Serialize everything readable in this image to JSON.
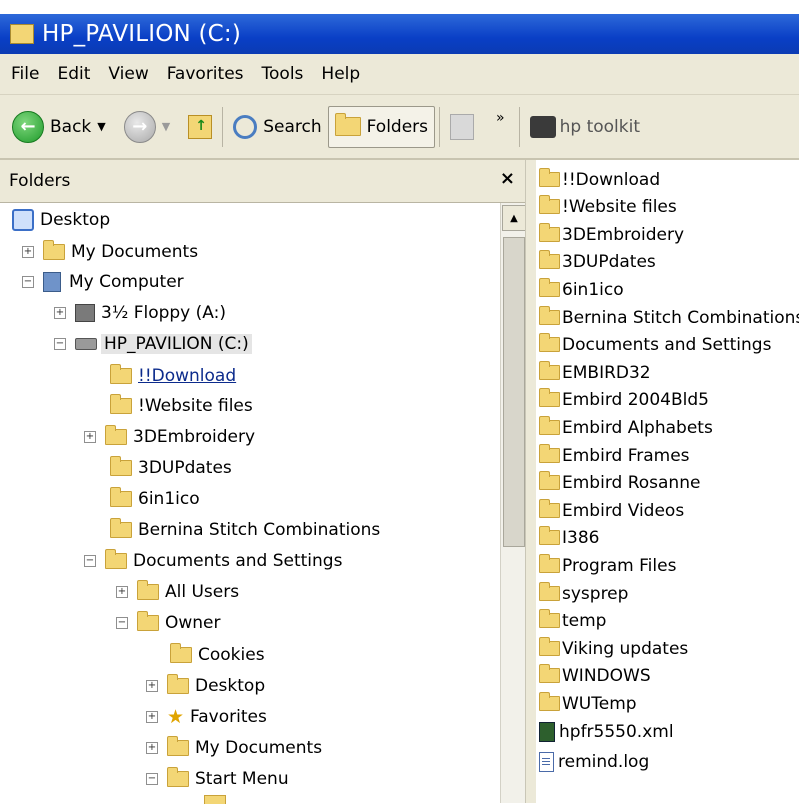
{
  "window": {
    "title": "HP_PAVILION (C:)"
  },
  "menu": [
    "File",
    "Edit",
    "View",
    "Favorites",
    "Tools",
    "Help"
  ],
  "toolbar": {
    "back_label": "Back",
    "search_label": "Search",
    "folders_label": "Folders",
    "chevron": "»",
    "hp_toolkit_label": "hp toolkit"
  },
  "folders_pane": {
    "title": "Folders",
    "close": "×",
    "tree": [
      {
        "label": "Desktop",
        "icon": "desktop-icon",
        "expander": ""
      },
      {
        "label": "My Documents",
        "icon": "folder-icon",
        "expander": "+"
      },
      {
        "label": "My Computer",
        "icon": "computer-icon",
        "expander": "−"
      },
      {
        "label": "3½ Floppy (A:)",
        "icon": "floppy-icon",
        "expander": "+"
      },
      {
        "label": "HP_PAVILION (C:)",
        "icon": "drive-icon",
        "expander": "−",
        "selected": true
      },
      {
        "label": "!!Download",
        "icon": "folder-icon",
        "expander": "",
        "link": true
      },
      {
        "label": "!Website files",
        "icon": "folder-icon",
        "expander": ""
      },
      {
        "label": "3DEmbroidery",
        "icon": "folder-icon",
        "expander": "+"
      },
      {
        "label": "3DUPdates",
        "icon": "folder-icon",
        "expander": ""
      },
      {
        "label": "6in1ico",
        "icon": "folder-icon",
        "expander": ""
      },
      {
        "label": "Bernina Stitch Combinations",
        "icon": "folder-icon",
        "expander": ""
      },
      {
        "label": "Documents and Settings",
        "icon": "folder-icon",
        "expander": "−"
      },
      {
        "label": "All Users",
        "icon": "folder-icon",
        "expander": "+"
      },
      {
        "label": "Owner",
        "icon": "folder-icon",
        "expander": "−"
      },
      {
        "label": "Cookies",
        "icon": "folder-icon",
        "expander": ""
      },
      {
        "label": "Desktop",
        "icon": "folder-icon",
        "expander": "+"
      },
      {
        "label": "Favorites",
        "icon": "star-icon",
        "expander": "+"
      },
      {
        "label": "My Documents",
        "icon": "folder-icon",
        "expander": "+"
      },
      {
        "label": "Start Menu",
        "icon": "folder-icon",
        "expander": "−"
      }
    ]
  },
  "contents": [
    {
      "label": "!!Download",
      "icon": "folder-icon"
    },
    {
      "label": "!Website files",
      "icon": "folder-icon"
    },
    {
      "label": "3DEmbroidery",
      "icon": "folder-icon"
    },
    {
      "label": "3DUPdates",
      "icon": "folder-icon"
    },
    {
      "label": "6in1ico",
      "icon": "folder-icon"
    },
    {
      "label": "Bernina Stitch Combinations",
      "icon": "folder-icon"
    },
    {
      "label": "Documents and Settings",
      "icon": "folder-icon"
    },
    {
      "label": "EMBIRD32",
      "icon": "folder-icon"
    },
    {
      "label": "Embird 2004Bld5",
      "icon": "folder-icon"
    },
    {
      "label": "Embird Alphabets",
      "icon": "folder-icon"
    },
    {
      "label": "Embird Frames",
      "icon": "folder-icon"
    },
    {
      "label": "Embird Rosanne",
      "icon": "folder-icon"
    },
    {
      "label": "Embird Videos",
      "icon": "folder-icon"
    },
    {
      "label": "I386",
      "icon": "folder-icon"
    },
    {
      "label": "Program Files",
      "icon": "folder-icon"
    },
    {
      "label": "sysprep",
      "icon": "folder-icon"
    },
    {
      "label": "temp",
      "icon": "folder-icon"
    },
    {
      "label": "Viking updates",
      "icon": "folder-icon"
    },
    {
      "label": "WINDOWS",
      "icon": "folder-icon"
    },
    {
      "label": "WUTemp",
      "icon": "folder-icon"
    },
    {
      "label": "hpfr5550.xml",
      "icon": "xml-file-icon"
    },
    {
      "label": "remind.log",
      "icon": "log-file-icon"
    }
  ],
  "colors": {
    "titlebar": "#0a3fc6",
    "chrome": "#ece9d8",
    "folder": "#f3d675",
    "link": "#0c2b8c"
  }
}
